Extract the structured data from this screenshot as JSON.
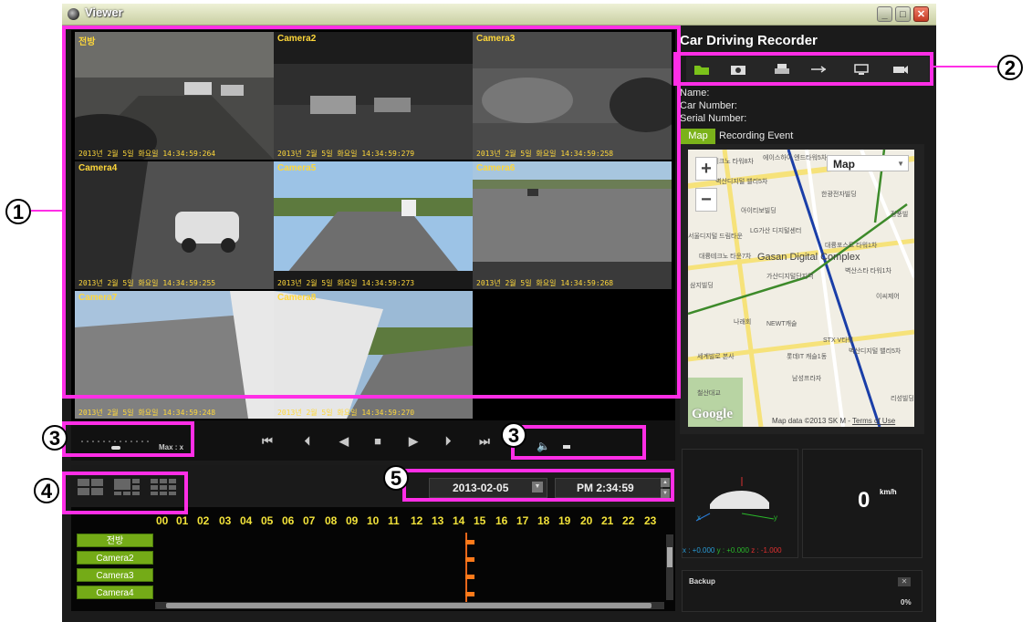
{
  "window": {
    "title": "Viewer",
    "min": "_",
    "max": "□",
    "close": "✕"
  },
  "cameras": [
    {
      "label": "전방",
      "timestamp": "2013년 2월 5일 화요일 14:34:59:264"
    },
    {
      "label": "Camera2",
      "timestamp": "2013년 2월 5일 화요일 14:34:59:279"
    },
    {
      "label": "Camera3",
      "timestamp": "2013년 2월 5일 화요일 14:34:59:258"
    },
    {
      "label": "Camera4",
      "timestamp": "2013년 2월 5일 화요일 14:34:59:255"
    },
    {
      "label": "Camera5",
      "timestamp": "2013년 2월 5일 화요일 14:34:59:273"
    },
    {
      "label": "Camera6",
      "timestamp": "2013년 2월 5일 화요일 14:34:59:268"
    },
    {
      "label": "Camera7",
      "timestamp": "2013년 2월 5일 화요일 14:34:59:248"
    },
    {
      "label": "Camera8",
      "timestamp": "2013년 2월 5일 화요일 14:34:59:270"
    }
  ],
  "right_panel": {
    "title": "Car Driving Recorder",
    "toolbar_icons": [
      "folder-icon",
      "camera-icon",
      "printer-icon",
      "usb-icon",
      "monitor-icon",
      "car-camera-icon"
    ],
    "info": {
      "name": "Name:",
      "car_number": "Car Number:",
      "serial_number": "Serial Number:"
    },
    "tabs": [
      {
        "label": "Map",
        "active": true
      },
      {
        "label": "Recording Event",
        "active": false
      }
    ],
    "map": {
      "zoom_in": "+",
      "zoom_out": "−",
      "type_select": "Map",
      "labels": [
        "에이스테크노 타워8차",
        "에이스하이 엔드타워5차",
        "벽산디지털 밸리5차",
        "한광전자빌딩",
        "아이티보빌딩",
        "정풍빌",
        "LG가산 디지털센터",
        "서울디지털 드림타운",
        "대륭테크노 타운7차",
        "대륭포스트 타워1차",
        "삼지빌딩",
        "가산디지털단지역",
        "벽산스타 타워1차",
        "이씨제어",
        "나래회",
        "NEWT캐슬",
        "STX V타워",
        "세계빌로 본사",
        "롯데IT 캐슬1동",
        "벽산디지털 밸리5차",
        "남성프라자",
        "철산대교",
        "리성빌딩"
      ],
      "big_label": "Gasan Digital Complex",
      "google": "Google",
      "copyright": "Map data ©2013 SK M",
      "terms": "Terms of Use"
    },
    "gsensor": {
      "x_axis": "x",
      "y_axis": "y",
      "reading_x": "x : +0.000",
      "reading_y": "y : +0.000",
      "reading_z": "z : -1.000"
    },
    "speed": {
      "value": "0",
      "unit": "km/h"
    },
    "backup": {
      "label": "Backup",
      "close": "✕",
      "percent": "0%"
    }
  },
  "playback": {
    "speed_max": "Max : x",
    "controls": [
      "skip-start-icon",
      "prev-frame-icon",
      "rewind-icon",
      "stop-icon",
      "play-icon",
      "next-frame-icon",
      "skip-end-icon"
    ],
    "control_glyphs": [
      "⏮",
      "⏴",
      "◀",
      "■",
      "▶",
      "⏵",
      "⏭"
    ],
    "volume_icon": "🔈"
  },
  "datetime": {
    "date": "2013-02-05",
    "time": "PM 2:34:59"
  },
  "timeline": {
    "hours": [
      "00",
      "01",
      "02",
      "03",
      "04",
      "05",
      "06",
      "07",
      "08",
      "09",
      "10",
      "11",
      "12",
      "13",
      "14",
      "15",
      "16",
      "17",
      "18",
      "19",
      "20",
      "21",
      "22",
      "23"
    ],
    "channels": [
      "전방",
      "Camera2",
      "Camera3",
      "Camera4"
    ]
  },
  "annotations": {
    "n1": "1",
    "n2": "2",
    "n3a": "3",
    "n3b": "3",
    "n4": "4",
    "n5": "5"
  },
  "colors": {
    "accent_magenta": "#ff2ee6",
    "channel_green": "#74ab17",
    "timeline_orange": "#ff7a1a",
    "hour_yellow": "#f2e23a",
    "cam_label_yellow": "#ffd83a"
  }
}
